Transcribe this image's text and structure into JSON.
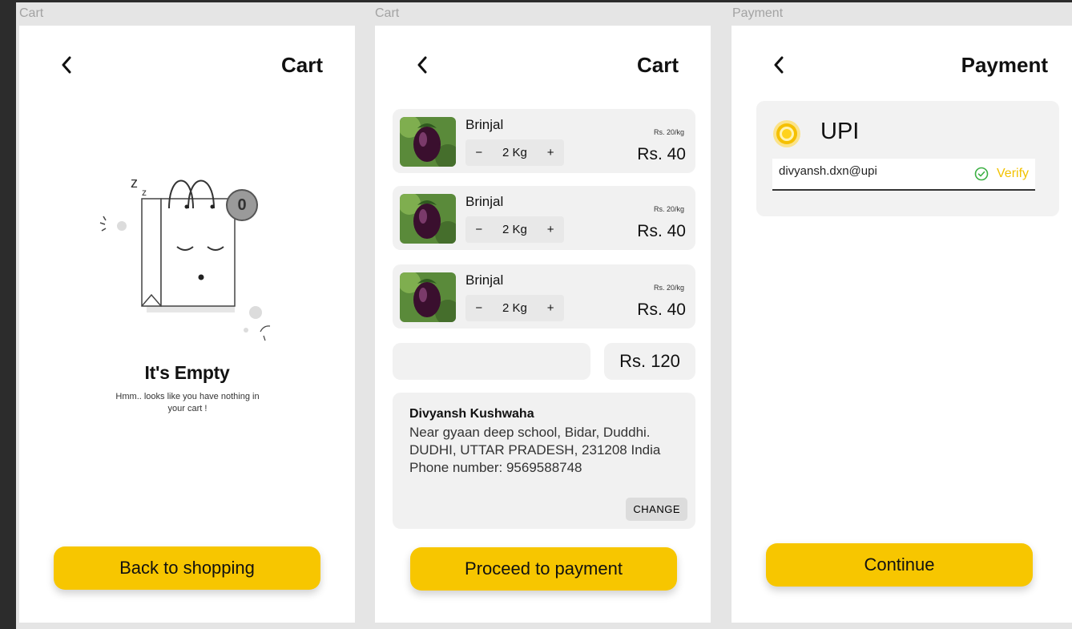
{
  "frames": {
    "empty_cart": {
      "frame_label": "Cart",
      "title": "Cart",
      "badge_count": "0",
      "empty_title": "It's Empty",
      "empty_message_line1": "Hmm.. looks like you have nothing in",
      "empty_message_line2": "your cart !",
      "button_label": "Back to shopping"
    },
    "cart": {
      "frame_label": "Cart",
      "title": "Cart",
      "items": [
        {
          "name": "Brinjal",
          "quantity": "2 Kg",
          "unit_price": "Rs. 20/kg",
          "total": "Rs. 40"
        },
        {
          "name": "Brinjal",
          "quantity": "2 Kg",
          "unit_price": "Rs. 20/kg",
          "total": "Rs. 40"
        },
        {
          "name": "Brinjal",
          "quantity": "2 Kg",
          "unit_price": "Rs. 20/kg",
          "total": "Rs. 40"
        }
      ],
      "decrement_symbol": "−",
      "increment_symbol": "+",
      "grand_total": "Rs. 120",
      "address": {
        "name": "Divyansh Kushwaha",
        "line1": "Near gyaan deep school, Bidar, Duddhi.",
        "line2": "DUDHI, UTTAR PRADESH, 231208 India",
        "phone": "Phone number: 9569588748",
        "change_label": "CHANGE"
      },
      "button_label": "Proceed to payment"
    },
    "payment": {
      "frame_label": "Payment",
      "title": "Payment",
      "method_label": "UPI",
      "upi_id": "divyansh.dxn@upi",
      "verify_label": "Verify",
      "button_label": "Continue"
    }
  },
  "colors": {
    "accent": "#f7c600",
    "verify_icon": "#3cb043",
    "card_background": "#f1f1f1",
    "canvas_background": "#e5e5e5"
  },
  "icons": [
    "back-arrow-icon",
    "shopping-bag-illustration",
    "minus-icon",
    "plus-icon",
    "check-circle-icon",
    "radio-selected-icon"
  ]
}
